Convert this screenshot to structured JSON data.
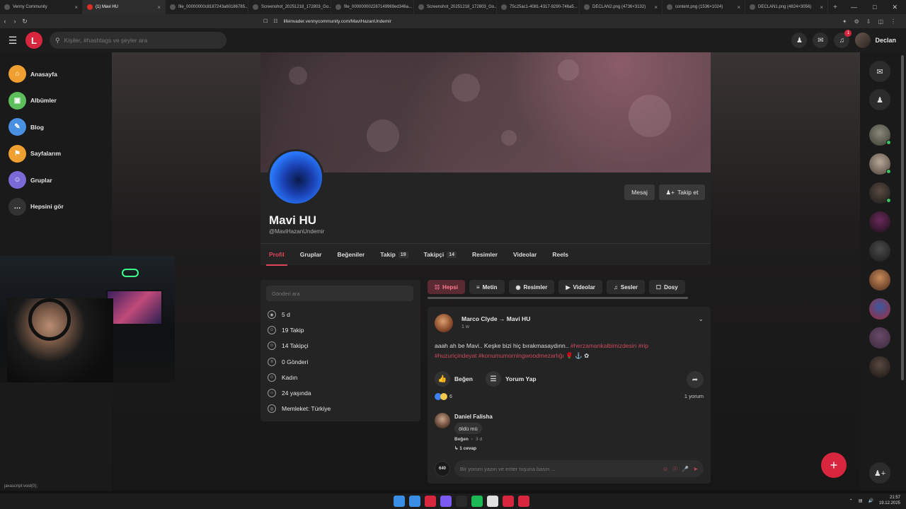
{
  "browser": {
    "tabs": [
      {
        "label": "Venny Community",
        "active": false
      },
      {
        "label": "(1) Mavi HU",
        "active": true
      },
      {
        "label": "file_00000000c8187243a60186785...",
        "active": false
      },
      {
        "label": "Screenshot_20251218_172803_Go...",
        "active": false
      },
      {
        "label": "file_000000002287149969ed346a...",
        "active": false
      },
      {
        "label": "Screenshot_20251218_172803_Go...",
        "active": false
      },
      {
        "label": "75c25ac1-4081-4317-9290-746a5...",
        "active": false
      },
      {
        "label": "DECLAN2.png (4736×3132)",
        "active": false
      },
      {
        "label": "content.png (1536×1024)",
        "active": false
      },
      {
        "label": "DECLAN1.png (4824×3056)",
        "active": false
      }
    ],
    "url": "lifeinvader.vennycommunity.com/MaviHazanUndemir",
    "status_url": "javascript:void(0);"
  },
  "header": {
    "logo_letter": "L",
    "search_placeholder": "Kişiler, #hashtags ve şeyler ara",
    "notification_count": "1",
    "username": "Declan"
  },
  "sidebar": {
    "items": [
      {
        "label": "Anasayfa",
        "color": "#f0a030"
      },
      {
        "label": "Albümler",
        "color": "#5cbf5c"
      },
      {
        "label": "Blog",
        "color": "#4a90e2"
      },
      {
        "label": "Sayfalarım",
        "color": "#f0a030"
      },
      {
        "label": "Gruplar",
        "color": "#7a6ad8"
      },
      {
        "label": "Hepsini gör",
        "color": "#333333"
      }
    ]
  },
  "profile": {
    "name": "Mavi HU",
    "handle": "@MaviHazanUndemir",
    "message_button": "Mesaj",
    "follow_button": "Takip et",
    "tabs": [
      {
        "label": "Profil",
        "count": ""
      },
      {
        "label": "Gruplar",
        "count": ""
      },
      {
        "label": "Beğeniler",
        "count": ""
      },
      {
        "label": "Takip",
        "count": "19"
      },
      {
        "label": "Takipçi",
        "count": "14"
      },
      {
        "label": "Resimler",
        "count": ""
      },
      {
        "label": "Videolar",
        "count": ""
      },
      {
        "label": "Reels",
        "count": ""
      }
    ]
  },
  "info": {
    "search_placeholder": "Gönderi ara",
    "rows": [
      {
        "icon": "eye-icon",
        "glyph": "◉",
        "text": "5 d"
      },
      {
        "icon": "user-icon",
        "glyph": "☺",
        "text": "19 Takip"
      },
      {
        "icon": "users-icon",
        "glyph": "☺",
        "text": "14 Takipçi"
      },
      {
        "icon": "document-icon",
        "glyph": "≡",
        "text": "0 Gönderi"
      },
      {
        "icon": "gender-icon",
        "glyph": "☺",
        "text": "Kadın"
      },
      {
        "icon": "cake-icon",
        "glyph": "⌂",
        "text": "24 yaşında"
      },
      {
        "icon": "globe-icon",
        "glyph": "◎",
        "text": "Memleket: Türkiye"
      }
    ]
  },
  "filters": [
    {
      "label": "Hepsi",
      "active": true
    },
    {
      "label": "Metin",
      "active": false
    },
    {
      "label": "Resimler",
      "active": false
    },
    {
      "label": "Videolar",
      "active": false
    },
    {
      "label": "Sesler",
      "active": false
    },
    {
      "label": "Dosy",
      "active": false
    }
  ],
  "post": {
    "author": "Marco Clyde",
    "arrow": "→",
    "target": "Mavi HU",
    "time": "1 w",
    "text": "aaah ah be Mavi.. Keşke bizi hiç bırakmasaydınn..",
    "tags1": "#herzamankalbimizdesin #rip",
    "tags2": "#huzuriçindeyat #konumumorningwoodmezarlığı",
    "like_label": "Beğen",
    "comment_label": "Yorum Yap",
    "reaction_count": "6",
    "reply_count": "1 yorum",
    "comment": {
      "author": "Daniel Falisha",
      "text": "öldü mü",
      "like_label": "Beğen",
      "time": "3 d",
      "replies": "1 cevap"
    },
    "my_avatar_label": "640",
    "comment_placeholder": "Bir yorum yazın ve enter tuşuna basın ..."
  },
  "rightbar": {
    "avatars": [
      {
        "colors": [
          "#8a8a7a",
          "#3a3a32"
        ],
        "online": true
      },
      {
        "colors": [
          "#b8a898",
          "#4a4038"
        ],
        "online": true
      },
      {
        "colors": [
          "#5a4a40",
          "#1a1a1a"
        ],
        "online": true
      },
      {
        "colors": [
          "#6a2a5a",
          "#1a1018"
        ],
        "online": false
      },
      {
        "colors": [
          "#4a4a4a",
          "#1a1a1a"
        ],
        "online": false
      },
      {
        "colors": [
          "#c88a5a",
          "#4a2a1a"
        ],
        "online": false
      },
      {
        "colors": [
          "#3a5aa0",
          "#a02a3a"
        ],
        "online": false
      },
      {
        "colors": [
          "#6a4a6a",
          "#3a2a3a"
        ],
        "online": false
      },
      {
        "colors": [
          "#5a4a40",
          "#1a1414"
        ],
        "online": false
      }
    ]
  },
  "taskbar": {
    "apps": [
      "#3a8ee6",
      "#d7263d",
      "#7a5af0",
      "#2a2a2a",
      "#1db954",
      "#e0e0e0",
      "#d7263d",
      "#d7263d"
    ],
    "time": "21:57",
    "date": "19.12.2025"
  },
  "colors": {
    "accent": "#d7263d",
    "tag": "#c84a5c"
  }
}
